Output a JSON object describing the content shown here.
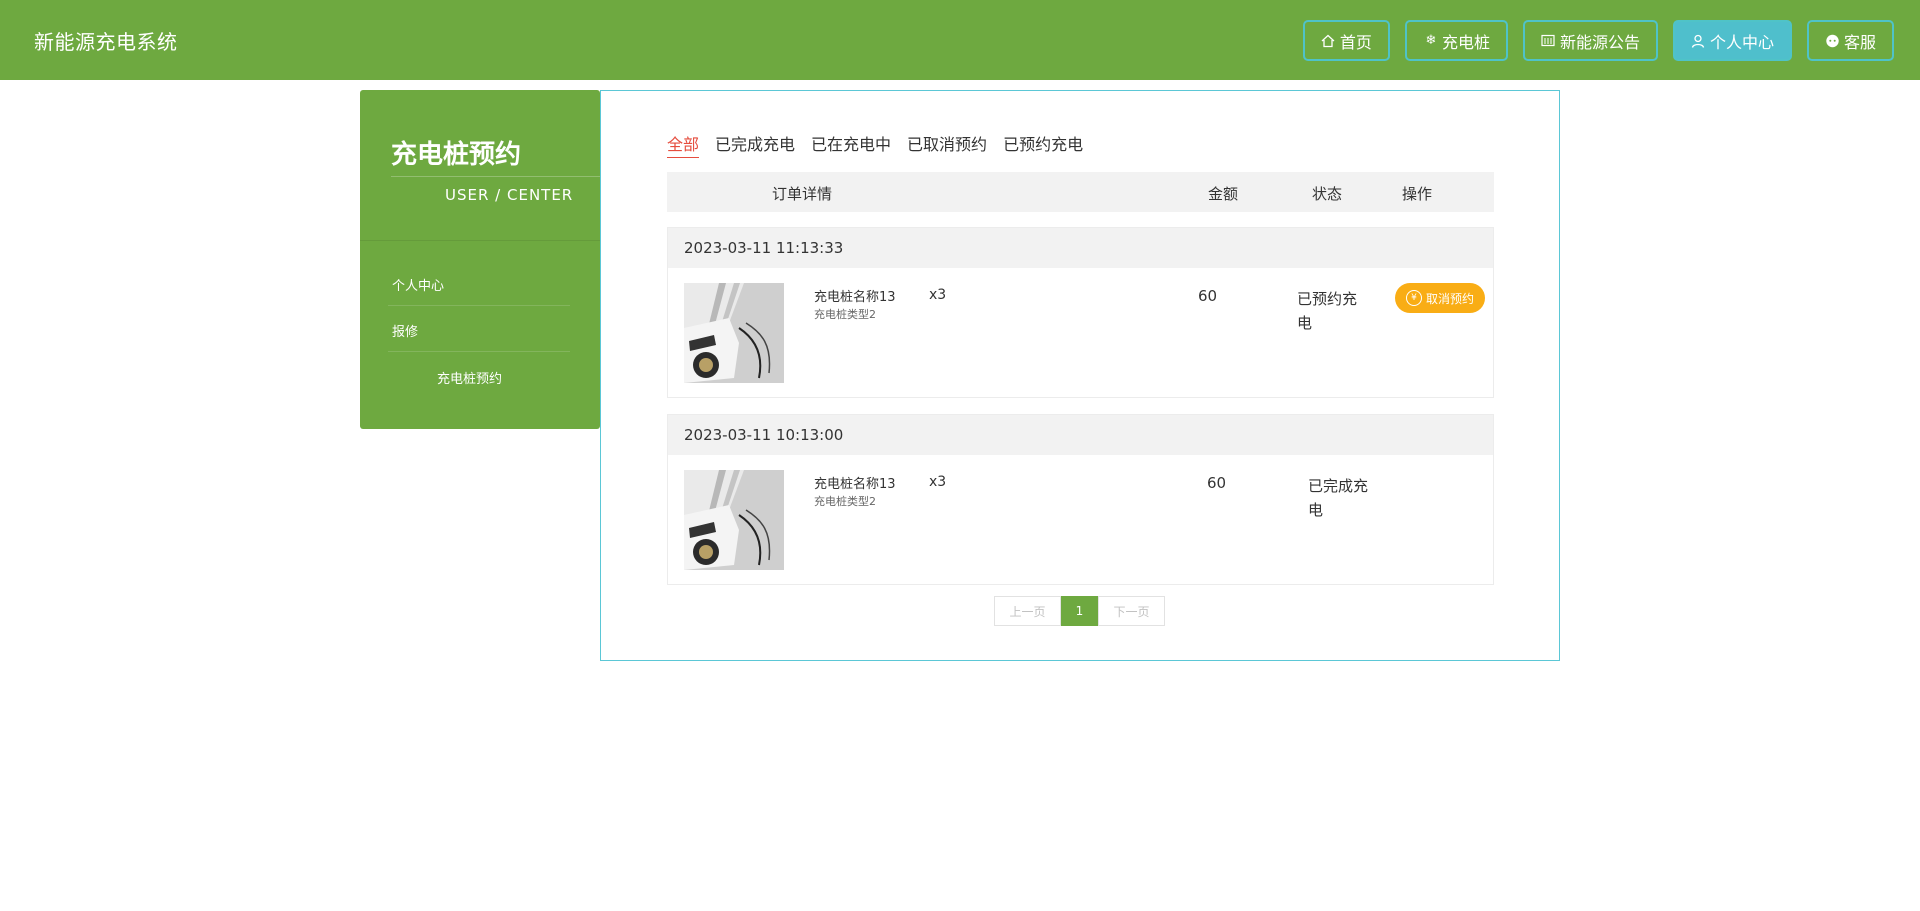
{
  "header": {
    "brand": "新能源充电系统",
    "nav": [
      {
        "label": "首页",
        "icon": "home-icon"
      },
      {
        "label": "充电桩",
        "icon": "snowflake-icon"
      },
      {
        "label": "新能源公告",
        "icon": "newspaper-icon"
      },
      {
        "label": "个人中心",
        "icon": "user-icon",
        "active": true
      },
      {
        "label": "客服",
        "icon": "chat-icon"
      }
    ]
  },
  "sidebar": {
    "title": "充电桩预约",
    "subtitle": "USER / CENTER",
    "items": [
      {
        "label": "个人中心"
      },
      {
        "label": "报修"
      },
      {
        "label": "充电桩预约",
        "active": true
      }
    ]
  },
  "tabs": [
    {
      "label": "全部",
      "active": true
    },
    {
      "label": "已完成充电"
    },
    {
      "label": "已在充电中"
    },
    {
      "label": "已取消预约"
    },
    {
      "label": "已预约充电"
    }
  ],
  "table": {
    "headers": {
      "detail": "订单详情",
      "amount": "金额",
      "status": "状态",
      "action": "操作"
    }
  },
  "orders": [
    {
      "time": "2023-03-11 11:13:33",
      "name": "充电桩名称13",
      "type": "充电桩类型2",
      "qty": "x3",
      "amount": "60",
      "status": "已预约充电",
      "action": "取消预约"
    },
    {
      "time": "2023-03-11 10:13:00",
      "name": "充电桩名称13",
      "type": "充电桩类型2",
      "qty": "x3",
      "amount": "60",
      "status": "已完成充电",
      "action": ""
    }
  ],
  "pager": {
    "prev": "上一页",
    "current": "1",
    "next": "下一页"
  },
  "colors": {
    "primary": "#6ea940",
    "accent": "#4fc3c8",
    "warning": "#f9ad15",
    "active_tab": "#e54d3e"
  }
}
